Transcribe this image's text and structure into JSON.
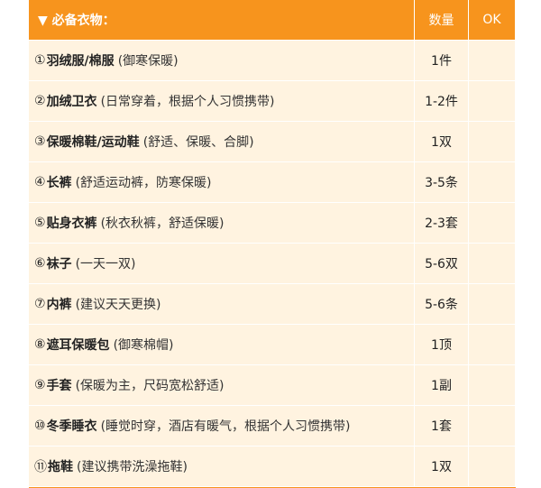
{
  "header": {
    "title": "▼ 必备衣物：",
    "qty_label": "数量",
    "ok_label": "OK"
  },
  "items": [
    {
      "num": "①",
      "name": "羽绒服/棉服",
      "desc": "(御寒保暖)",
      "qty": "1件",
      "ok": ""
    },
    {
      "num": "②",
      "name": "加绒卫衣",
      "desc": "(日常穿着，根据个人习惯携带)",
      "qty": "1-2件",
      "ok": ""
    },
    {
      "num": "③",
      "name": "保暖棉鞋/运动鞋",
      "desc": "(舒适、保暖、合脚)",
      "qty": "1双",
      "ok": ""
    },
    {
      "num": "④",
      "name": "长裤",
      "desc": "(舒适运动裤，防寒保暖)",
      "qty": "3-5条",
      "ok": ""
    },
    {
      "num": "⑤",
      "name": "贴身衣裤",
      "desc": "(秋衣秋裤，舒适保暖)",
      "qty": "2-3套",
      "ok": ""
    },
    {
      "num": "⑥",
      "name": "袜子",
      "desc": "(一天一双)",
      "qty": "5-6双",
      "ok": ""
    },
    {
      "num": "⑦",
      "name": "内裤",
      "desc": "(建议天天更换)",
      "qty": "5-6条",
      "ok": ""
    },
    {
      "num": "⑧",
      "name": "遮耳保暖包",
      "desc": "(御寒棉帽)",
      "qty": "1顶",
      "ok": ""
    },
    {
      "num": "⑨",
      "name": "手套",
      "desc": "(保暖为主，尺码宽松舒适)",
      "qty": "1副",
      "ok": ""
    },
    {
      "num": "⑩",
      "name": "冬季睡衣",
      "desc": "(睡觉时穿，酒店有暖气，根据个人习惯携带)",
      "qty": "1套",
      "ok": ""
    },
    {
      "num": "⑪",
      "name": "拖鞋",
      "desc": "(建议携带洗澡拖鞋)",
      "qty": "1双",
      "ok": ""
    }
  ]
}
